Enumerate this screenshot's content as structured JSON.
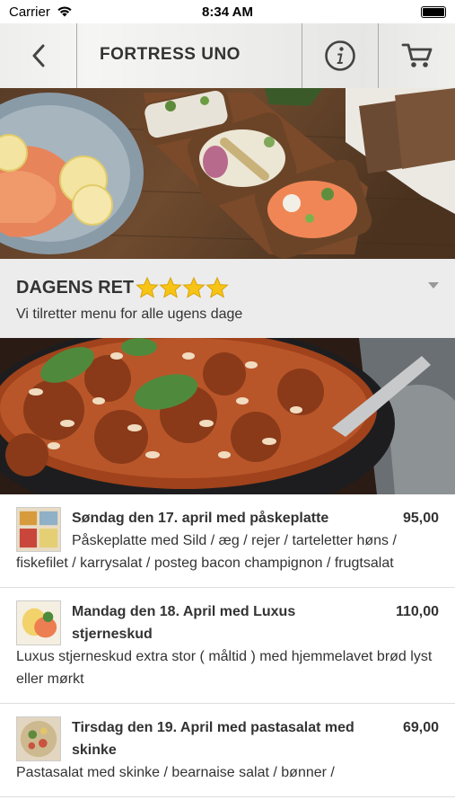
{
  "status_bar": {
    "carrier": "Carrier",
    "time": "8:34 AM"
  },
  "navbar": {
    "title": "FORTRESS UNO",
    "back_icon": "chevron-left-icon",
    "info_icon": "info-icon",
    "cart_icon": "cart-icon"
  },
  "section": {
    "title": "DAGENS RET",
    "stars": 4,
    "subtitle": "Vi tilretter menu for alle ugens dage"
  },
  "menu": {
    "items": [
      {
        "title": "Søndag den 17. april med påskeplatte",
        "price": "95,00",
        "description": "Påskeplatte med Sild / æg / rejer / tarteletter høns / fiskefilet / karrysalat / posteg bacon champignon / frugtsalat"
      },
      {
        "title": "Mandag den 18. April med Luxus stjerneskud",
        "price": "110,00",
        "description": "Luxus stjerneskud extra stor ( måltid ) med hjemmelavet brød lyst eller mørkt"
      },
      {
        "title": "Tirsdag den 19. April med pastasalat med skinke",
        "price": "69,00",
        "description": "Pastasalat med skinke / bearnaise salat / bønner /"
      }
    ]
  },
  "colors": {
    "navbar_divider": "#a9a9a5",
    "section_bg": "#ececec",
    "star": "#f7c416",
    "text": "#333333"
  }
}
